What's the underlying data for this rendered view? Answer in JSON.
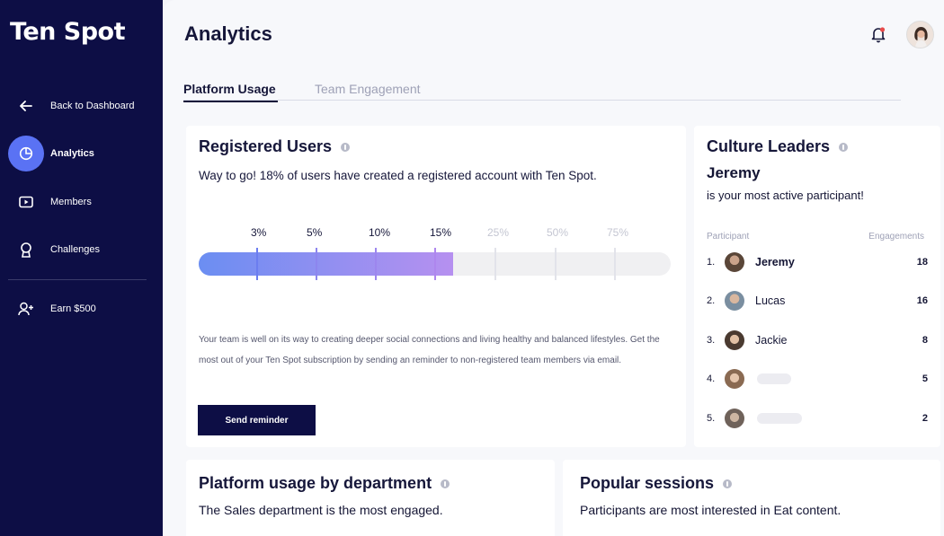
{
  "app": {
    "logo": "Ten Spot"
  },
  "sidebar": {
    "items": [
      {
        "label": "Back to Dashboard",
        "icon": "arrow-left-icon"
      },
      {
        "label": "Analytics",
        "icon": "pie-chart-icon",
        "active": true
      },
      {
        "label": "Members",
        "icon": "play-square-icon"
      },
      {
        "label": "Challenges",
        "icon": "award-icon"
      },
      {
        "label": "Earn $500",
        "icon": "user-plus-icon"
      }
    ]
  },
  "header": {
    "title": "Analytics"
  },
  "tabs": [
    {
      "label": "Platform Usage",
      "active": true
    },
    {
      "label": "Team Engagement",
      "active": false
    }
  ],
  "registered": {
    "title": "Registered Users",
    "subtitle": "Way to go! 18% of users have created a registered account with Ten Spot.",
    "progress_percent": 18,
    "milestones": [
      "3%",
      "5%",
      "10%",
      "15%",
      "25%",
      "50%",
      "75%"
    ],
    "description": "Your team is well on its way to creating deeper social connections and living healthy and balanced lifestyles. Get the most out of your Ten Spot subscription by sending an reminder to non-registered team members via email.",
    "button": "Send reminder"
  },
  "culture": {
    "title": "Culture Leaders",
    "top_name": "Jeremy",
    "top_sub": "is your most active participant!",
    "col_participant": "Participant",
    "col_engagements": "Engagements",
    "leaders": [
      {
        "rank": "1.",
        "name": "Jeremy",
        "engagements": "18"
      },
      {
        "rank": "2.",
        "name": "Lucas",
        "engagements": "16"
      },
      {
        "rank": "3.",
        "name": "Jackie",
        "engagements": "8"
      },
      {
        "rank": "4.",
        "name": "",
        "engagements": "5"
      },
      {
        "rank": "5.",
        "name": "",
        "engagements": "2"
      }
    ]
  },
  "department": {
    "title": "Platform usage by department",
    "subtitle": "The Sales department is the most engaged."
  },
  "popular": {
    "title": "Popular sessions",
    "subtitle": "Participants are most interested in Eat content."
  },
  "colors": {
    "sidebar": "#0d0e45",
    "accent": "#5a72f4",
    "bar_start": "#6b8ef2",
    "bar_end": "#b690f0"
  }
}
